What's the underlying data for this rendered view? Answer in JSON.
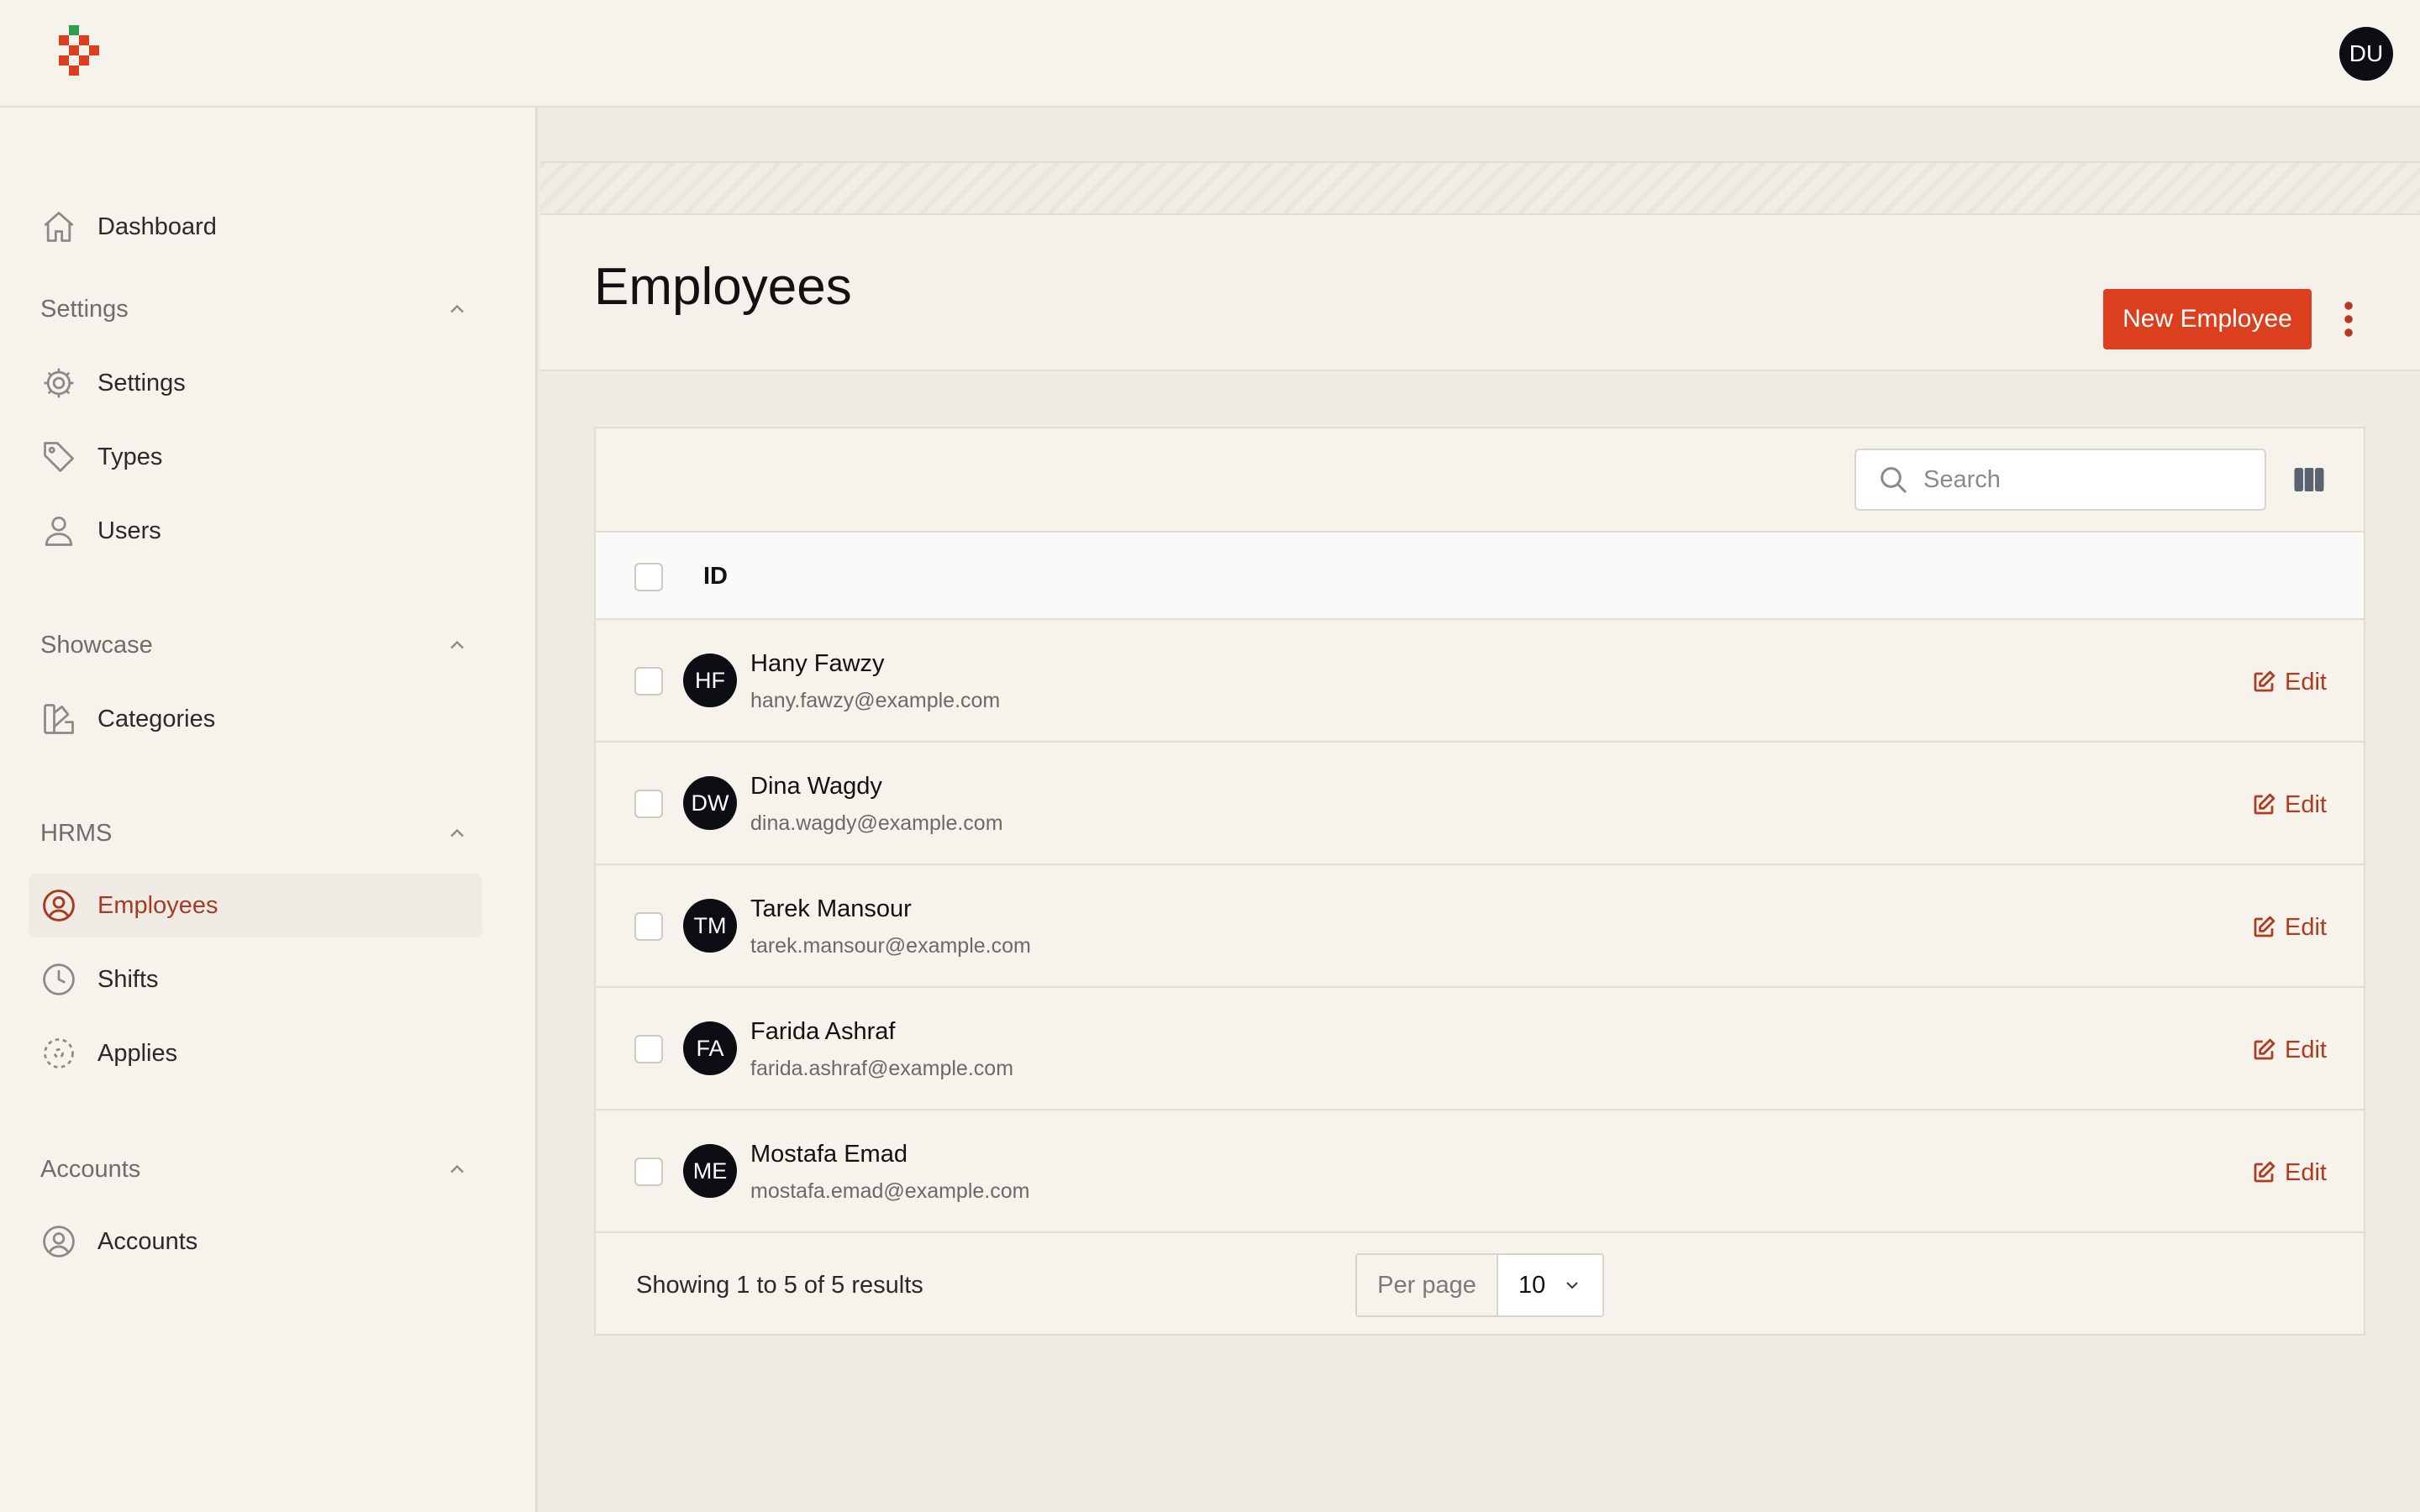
{
  "user": {
    "initials": "DU"
  },
  "sidebar": {
    "dashboard": "Dashboard",
    "groups": {
      "settings": {
        "label": "Settings",
        "items": [
          "Settings",
          "Types",
          "Users"
        ]
      },
      "showcase": {
        "label": "Showcase",
        "items": [
          "Categories"
        ]
      },
      "hrms": {
        "label": "HRMS",
        "items": [
          "Employees",
          "Shifts",
          "Applies"
        ]
      },
      "accounts": {
        "label": "Accounts",
        "items": [
          "Accounts"
        ]
      }
    },
    "active_item": "Employees"
  },
  "page": {
    "title": "Employees",
    "new_button": "New Employee"
  },
  "table": {
    "search_placeholder": "Search",
    "column_id": "ID",
    "rows": [
      {
        "initials": "HF",
        "name": "Hany Fawzy",
        "email": "hany.fawzy@example.com",
        "action": "Edit"
      },
      {
        "initials": "DW",
        "name": "Dina Wagdy",
        "email": "dina.wagdy@example.com",
        "action": "Edit"
      },
      {
        "initials": "TM",
        "name": "Tarek Mansour",
        "email": "tarek.mansour@example.com",
        "action": "Edit"
      },
      {
        "initials": "FA",
        "name": "Farida Ashraf",
        "email": "farida.ashraf@example.com",
        "action": "Edit"
      },
      {
        "initials": "ME",
        "name": "Mostafa Emad",
        "email": "mostafa.emad@example.com",
        "action": "Edit"
      }
    ],
    "showing": "Showing 1 to 5 of 5 results",
    "per_page_label": "Per page",
    "per_page_value": "10"
  },
  "colors": {
    "accent": "#dc3f1e",
    "accent_text": "#a63a22",
    "avatar_bg": "#0d0d14",
    "page_bg": "#f0ebe1",
    "panel_bg": "#f6f2ec"
  },
  "icons": {
    "logo": "brand-logo",
    "dashboard": "home-icon",
    "settings": "gear-icon",
    "types": "tag-icon",
    "users": "user-icon",
    "categories": "swatch-icon",
    "employees": "user-circle-icon",
    "shifts": "clock-icon",
    "applies": "scan-icon",
    "accounts": "user-circle-icon",
    "group_toggle": "chevron-up-icon",
    "search": "search-icon",
    "columns": "columns-icon",
    "more": "kebab-icon",
    "edit": "edit-icon",
    "select": "chevron-down-icon"
  }
}
